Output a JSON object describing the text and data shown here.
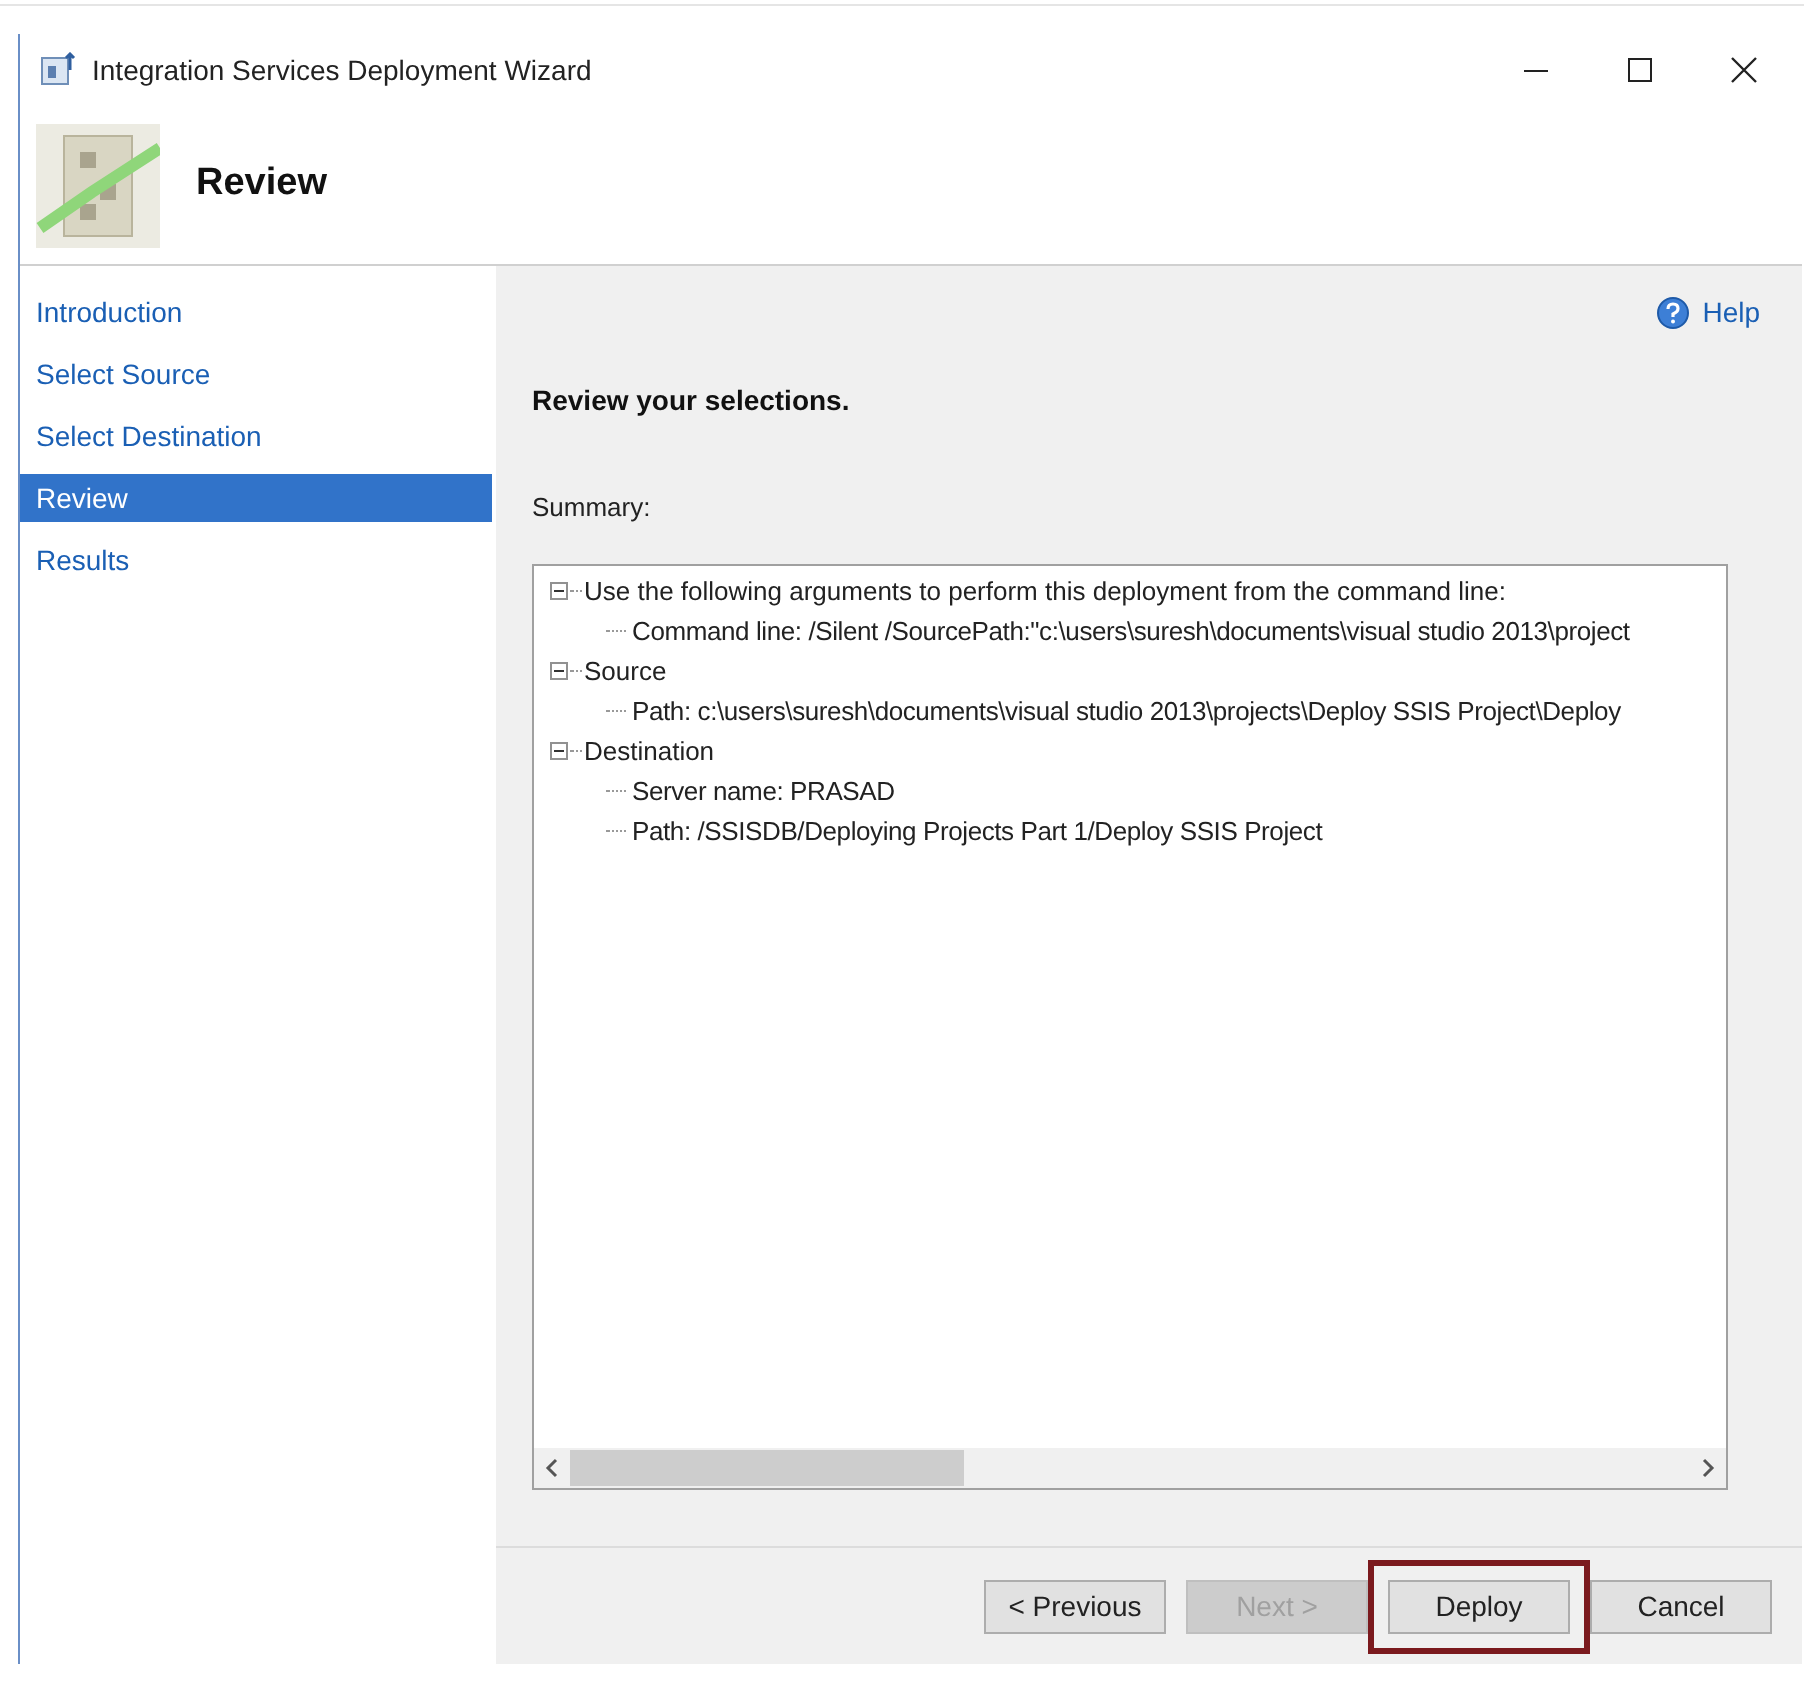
{
  "window": {
    "title": "Integration Services Deployment Wizard"
  },
  "header": {
    "title": "Review"
  },
  "sidebar": {
    "items": [
      {
        "label": "Introduction",
        "selected": false
      },
      {
        "label": "Select Source",
        "selected": false
      },
      {
        "label": "Select Destination",
        "selected": false
      },
      {
        "label": "Review",
        "selected": true
      },
      {
        "label": "Results",
        "selected": false
      }
    ]
  },
  "help": {
    "label": "Help"
  },
  "heading": "Review your selections.",
  "summary": {
    "label": "Summary:",
    "tree": [
      {
        "label": "Use the following arguments to perform this deployment from the command line:",
        "expanded": true,
        "children": [
          {
            "label": "Command line: /Silent /SourcePath:\"c:\\users\\suresh\\documents\\visual studio 2013\\project"
          }
        ]
      },
      {
        "label": "Source",
        "expanded": true,
        "children": [
          {
            "label": "Path: c:\\users\\suresh\\documents\\visual studio 2013\\projects\\Deploy SSIS Project\\Deploy"
          }
        ]
      },
      {
        "label": "Destination",
        "expanded": true,
        "children": [
          {
            "label": "Server name: PRASAD"
          },
          {
            "label": "Path: /SSISDB/Deploying Projects Part 1/Deploy SSIS Project"
          }
        ]
      }
    ]
  },
  "buttons": [
    {
      "label": "< Previous",
      "disabled": false,
      "highlighted": false
    },
    {
      "label": "Next >",
      "disabled": true,
      "highlighted": false
    },
    {
      "label": "Deploy",
      "disabled": false,
      "highlighted": true
    },
    {
      "label": "Cancel",
      "disabled": false,
      "highlighted": false
    }
  ]
}
